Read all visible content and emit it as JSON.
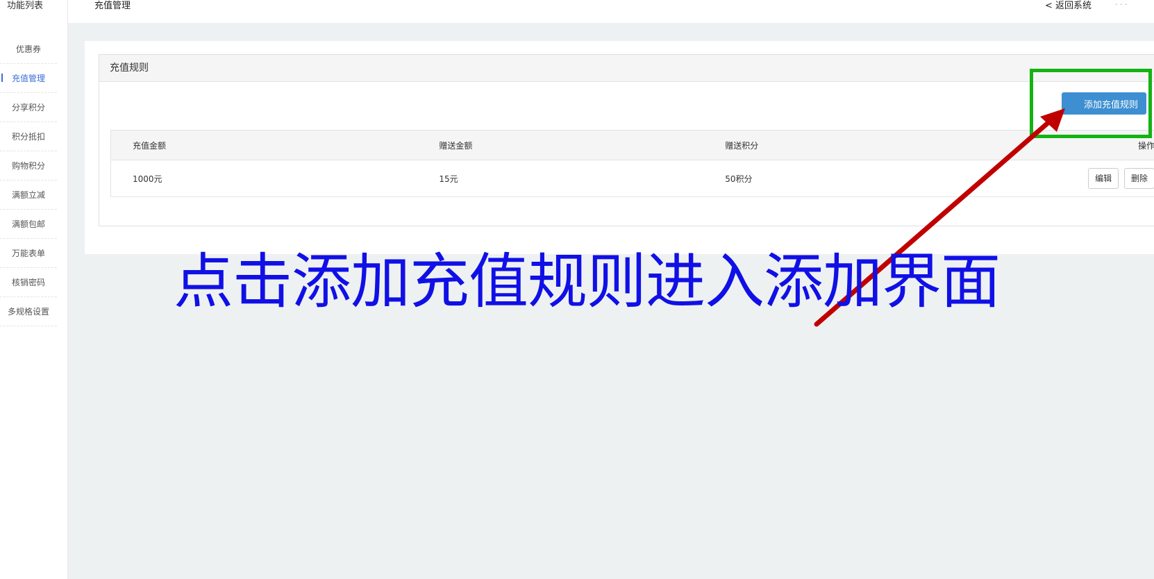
{
  "sidebar": {
    "title": "功能列表",
    "items": [
      {
        "label": "优惠券"
      },
      {
        "label": "充值管理",
        "active": true
      },
      {
        "label": "分享积分"
      },
      {
        "label": "积分抵扣"
      },
      {
        "label": "购物积分"
      },
      {
        "label": "满额立减"
      },
      {
        "label": "满额包邮"
      },
      {
        "label": "万能表单"
      },
      {
        "label": "核销密码"
      },
      {
        "label": "多规格设置"
      }
    ]
  },
  "header": {
    "title": "充值管理",
    "back_label": "< 返回系统"
  },
  "panel": {
    "title": "充值规则",
    "add_button": "添加充值规则",
    "table": {
      "columns": [
        "充值金额",
        "赠送金额",
        "赠送积分",
        "操作"
      ],
      "rows": [
        {
          "amount": "1000元",
          "bonus_amount": "15元",
          "bonus_points": "50积分",
          "edit_label": "编辑",
          "delete_label": "删除"
        }
      ]
    }
  },
  "annotation": {
    "text": "点击添加充值规则进入添加界面",
    "text_color": "#1010e6",
    "highlight_color": "#13b313",
    "arrow_color": "#c00000"
  },
  "colors": {
    "accent": "#3d8fd1",
    "active_menu": "#3b6fd6"
  }
}
